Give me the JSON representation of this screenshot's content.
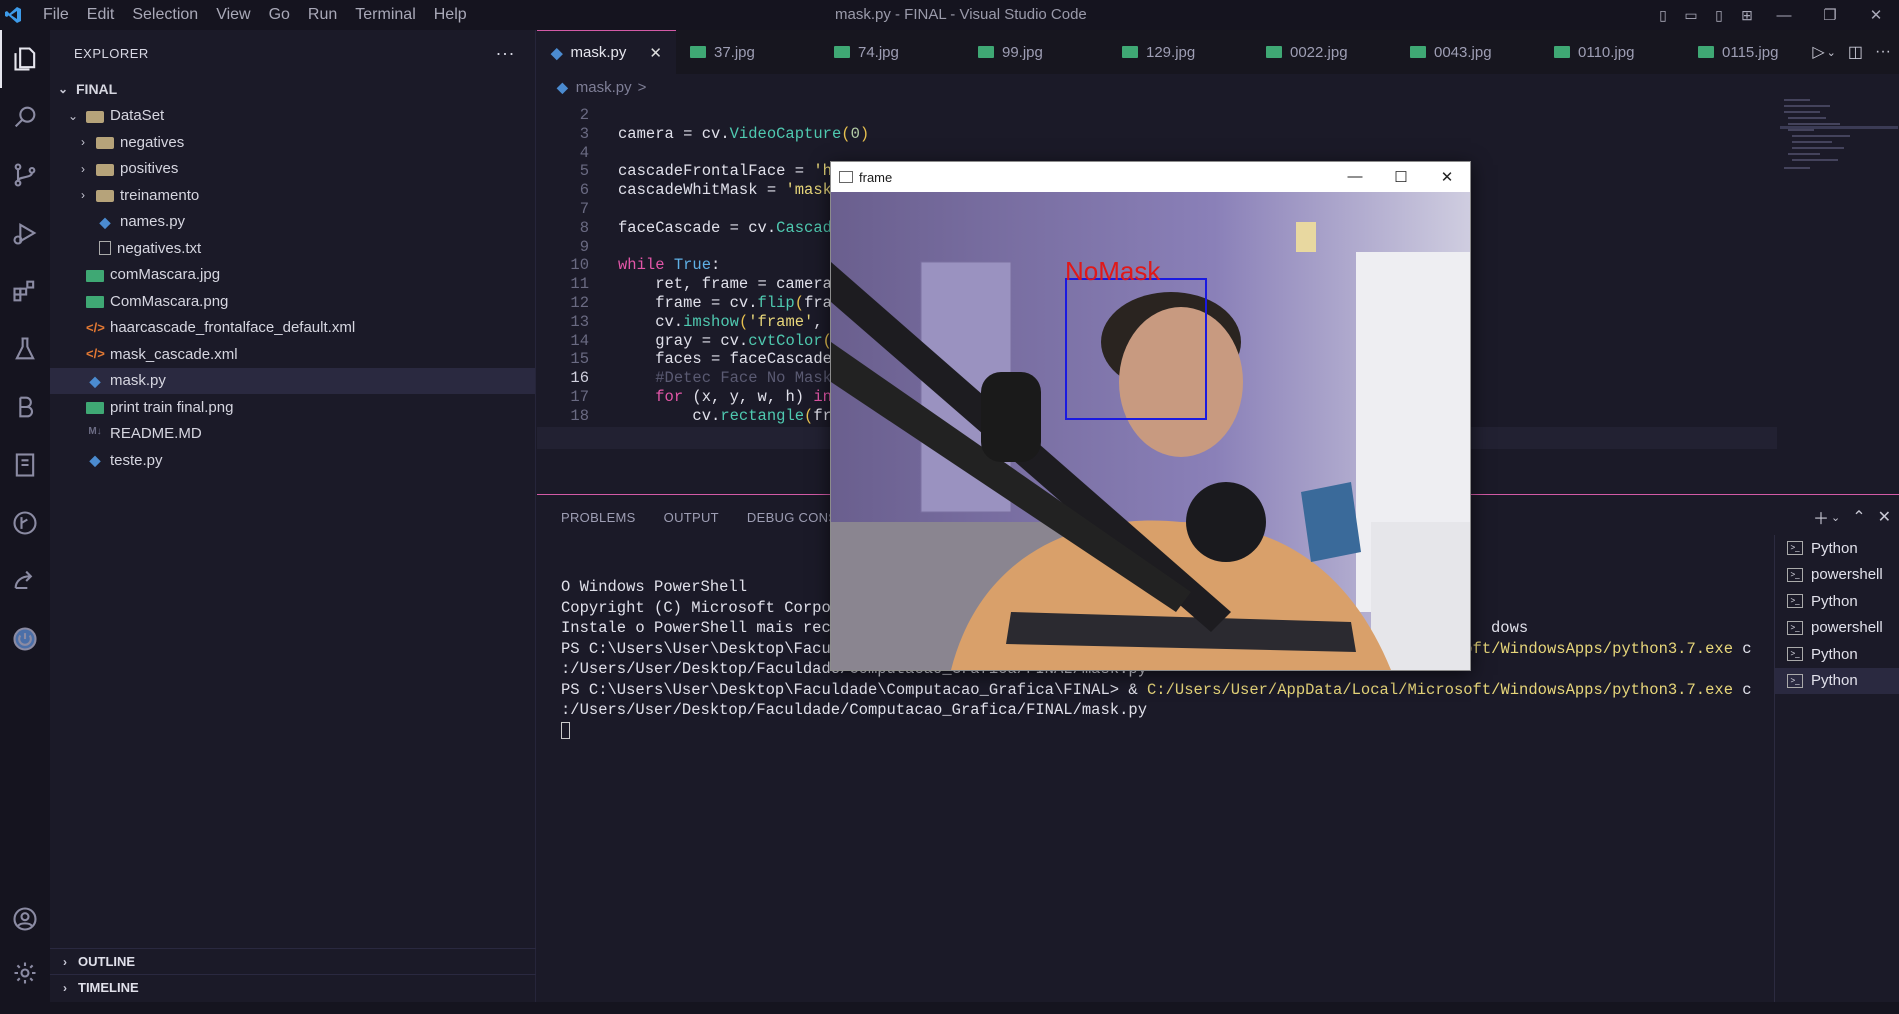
{
  "window": {
    "title": "mask.py - FINAL - Visual Studio Code",
    "menu": [
      "File",
      "Edit",
      "Selection",
      "View",
      "Go",
      "Run",
      "Terminal",
      "Help"
    ]
  },
  "sidebar": {
    "title": "EXPLORER",
    "root": "FINAL",
    "items": [
      {
        "label": "DataSet",
        "type": "folder-open",
        "depth": 1
      },
      {
        "label": "negatives",
        "type": "folder",
        "depth": 2
      },
      {
        "label": "positives",
        "type": "folder",
        "depth": 2
      },
      {
        "label": "treinamento",
        "type": "folder",
        "depth": 2
      },
      {
        "label": "names.py",
        "type": "py",
        "depth": 2
      },
      {
        "label": "negatives.txt",
        "type": "txt",
        "depth": 2
      },
      {
        "label": "comMascara.jpg",
        "type": "img",
        "depth": 1
      },
      {
        "label": "ComMascara.png",
        "type": "img",
        "depth": 1
      },
      {
        "label": "haarcascade_frontalface_default.xml",
        "type": "xml",
        "depth": 1
      },
      {
        "label": "mask_cascade.xml",
        "type": "xml",
        "depth": 1
      },
      {
        "label": "mask.py",
        "type": "py",
        "depth": 1,
        "selected": true
      },
      {
        "label": "print train final.png",
        "type": "img",
        "depth": 1
      },
      {
        "label": "README.MD",
        "type": "md",
        "depth": 1
      },
      {
        "label": "teste.py",
        "type": "py",
        "depth": 1
      }
    ],
    "outline": "OUTLINE",
    "timeline": "TIMELINE"
  },
  "tabs": [
    {
      "label": "mask.py",
      "type": "py",
      "active": true
    },
    {
      "label": "37.jpg",
      "type": "img"
    },
    {
      "label": "74.jpg",
      "type": "img"
    },
    {
      "label": "99.jpg",
      "type": "img"
    },
    {
      "label": "129.jpg",
      "type": "img"
    },
    {
      "label": "0022.jpg",
      "type": "img"
    },
    {
      "label": "0043.jpg",
      "type": "img"
    },
    {
      "label": "0110.jpg",
      "type": "img"
    },
    {
      "label": "0115.jpg",
      "type": "img"
    }
  ],
  "breadcrumb": {
    "file": "mask.py",
    "sep": ">"
  },
  "code_lines": [
    {
      "n": "2",
      "html": ""
    },
    {
      "n": "3",
      "html": "camera = cv.<span class='fn'>VideoCapture</span><span class='par'>(</span><span class='num'>0</span><span class='par'>)</span>"
    },
    {
      "n": "4",
      "html": ""
    },
    {
      "n": "5",
      "html": "cascadeFrontalFace = <span class='str'>'h</span>"
    },
    {
      "n": "6",
      "html": "cascadeWhitMask = <span class='str'>'mask</span>"
    },
    {
      "n": "7",
      "html": ""
    },
    {
      "n": "8",
      "html": "faceCascade = cv.<span class='fn'>Cascad</span>"
    },
    {
      "n": "9",
      "html": ""
    },
    {
      "n": "10",
      "html": "<span class='kw'>while</span> <span class='bi'>True</span>:"
    },
    {
      "n": "11",
      "html": "    ret, frame = camera"
    },
    {
      "n": "12",
      "html": "    frame = cv.<span class='fn'>flip</span><span class='par'>(</span>fra"
    },
    {
      "n": "13",
      "html": "    cv.<span class='fn'>imshow</span><span class='par'>(</span><span class='str'>'frame'</span>,"
    },
    {
      "n": "14",
      "html": "    gray = cv.<span class='fn'>cvtColor</span><span class='par'>(</span>"
    },
    {
      "n": "15",
      "html": "    faces = faceCascade"
    },
    {
      "n": "16",
      "html": "    <span class='cmt'>#Detec Face No Mask</span>"
    },
    {
      "n": "17",
      "html": "    <span class='kw'>for</span> (x, y, w, h) <span class='kw'>in</span>"
    },
    {
      "n": "18",
      "html": "        cv.<span class='fn'>rectangle</span><span class='par'>(</span>fr"
    }
  ],
  "panel": {
    "tabs": [
      "PROBLEMS",
      "OUTPUT",
      "DEBUG CONSOLE"
    ],
    "terminal_lines": [
      "O Windows PowerShell",
      "Copyright (C) Microsoft Corpo",
      "",
      "Instale o PowerShell mais rec",
      "",
      "PS C:\\Users\\User\\Desktop\\Faculdade\\Computacao_Grafica\\FINAL> & ",
      ":/Users/User/Desktop/Faculdade/Computacao_Grafica/FINAL/mask.py",
      "PS C:\\Users\\User\\Desktop\\Faculdade\\Computacao_Grafica\\FINAL> & ",
      ":/Users/User/Desktop/Faculdade/Computacao_Grafica/FINAL/mask.py"
    ],
    "python_path": "C:/Users/User/AppData/Local/Microsoft/WindowsApps/python3.7.exe",
    "python_path_suffix": " c",
    "windows_suffix": "dows",
    "terminals": [
      "Python",
      "powershell",
      "Python",
      "powershell",
      "Python",
      "Python"
    ]
  },
  "frame_window": {
    "title": "frame",
    "detection_label": "NoMask"
  }
}
